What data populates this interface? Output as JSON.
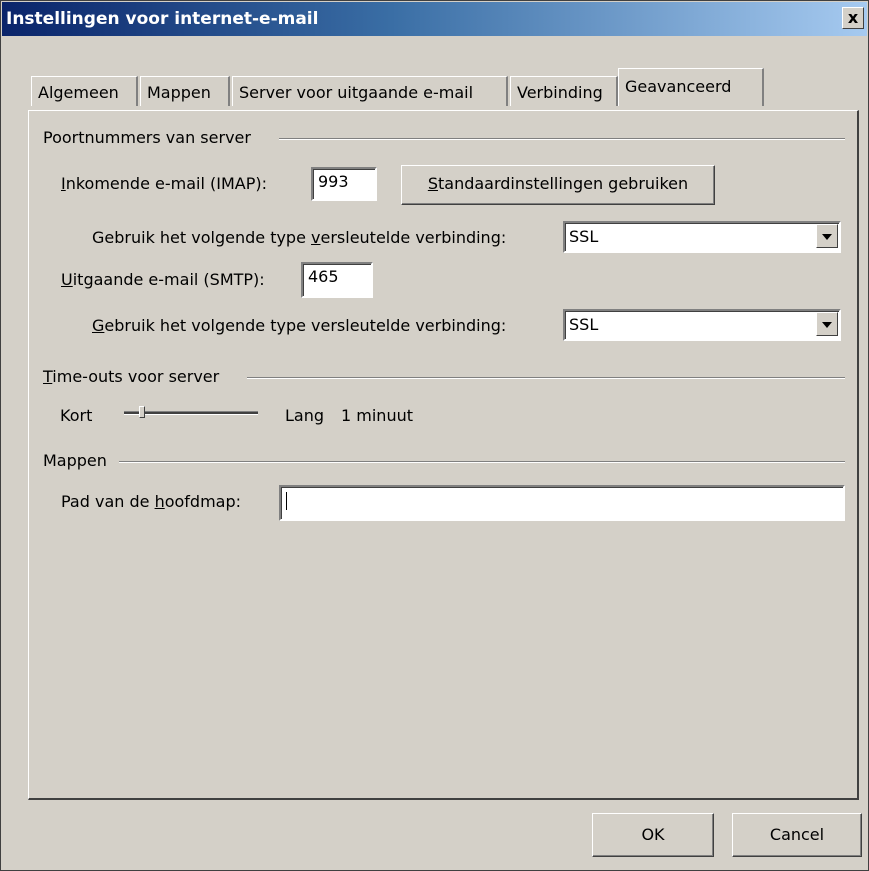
{
  "window": {
    "title": "Instellingen voor internet-e-mail",
    "close_label": "x"
  },
  "tabs": [
    {
      "label": "Algemeen"
    },
    {
      "label": "Mappen"
    },
    {
      "label": "Server voor uitgaande e-mail"
    },
    {
      "label": "Verbinding"
    },
    {
      "label": "Geavanceerd"
    }
  ],
  "ports": {
    "group_label": "Poortnummers van server",
    "incoming": {
      "label_underline": "I",
      "label_rest": "nkomende e-mail (IMAP):",
      "value": "993"
    },
    "defaults_button": {
      "underline": "S",
      "rest": "tandaardinstellingen gebruiken"
    },
    "incoming_encryption": {
      "label_pre": "Gebruik het volgende type ",
      "label_underline": "v",
      "label_post": "ersleutelde verbinding:",
      "value": "SSL"
    },
    "outgoing": {
      "label_underline": "U",
      "label_rest": "itgaande e-mail (SMTP):",
      "value": "465"
    },
    "outgoing_encryption": {
      "label_underline": "G",
      "label_rest": "ebruik het volgende type versleutelde verbinding:",
      "value": "SSL"
    }
  },
  "timeouts": {
    "group_label_underline": "T",
    "group_label_rest": "ime-outs voor server",
    "short_label": "Kort",
    "long_label": "Lang",
    "value_text": "1 minuut",
    "slider_level": 0.12
  },
  "folders": {
    "group_label": "Mappen",
    "root_label_pre": "Pad van de ",
    "root_label_underline": "h",
    "root_label_post": "oofdmap:",
    "root_value": ""
  },
  "footer": {
    "ok_label": "OK",
    "cancel_label": "Cancel"
  }
}
